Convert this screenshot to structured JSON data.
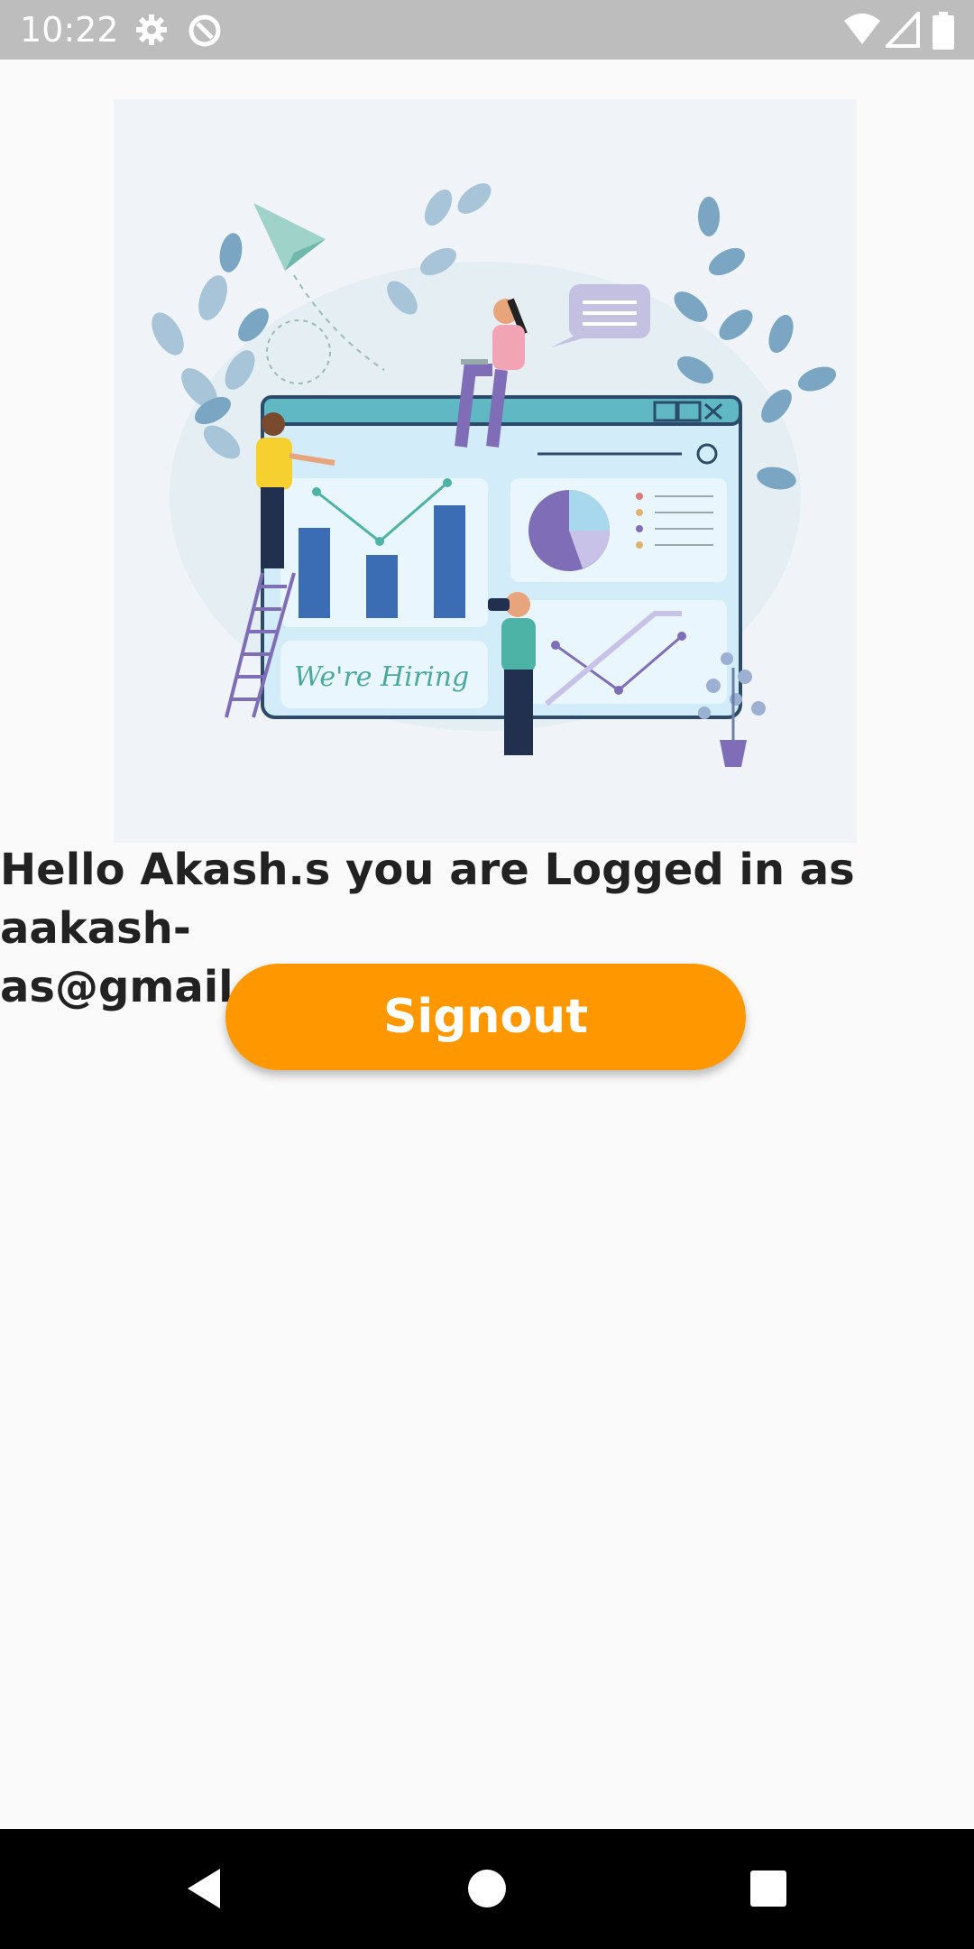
{
  "status_bar": {
    "time": "10:22",
    "icons": [
      "settings-icon",
      "data-saver-icon",
      "wifi-icon",
      "cell-signal-icon",
      "battery-icon"
    ]
  },
  "hero": {
    "illustration_text": "We're Hiring",
    "icon": "hiring-illustration"
  },
  "greeting": {
    "text": "Hello Akash.s you are Logged in as aakash-\nas@gmail.com"
  },
  "signout_button": {
    "label": "Signout",
    "color": "#ff9800"
  },
  "nav_bar": {
    "icons": [
      "back-icon",
      "home-icon",
      "recents-icon"
    ]
  }
}
